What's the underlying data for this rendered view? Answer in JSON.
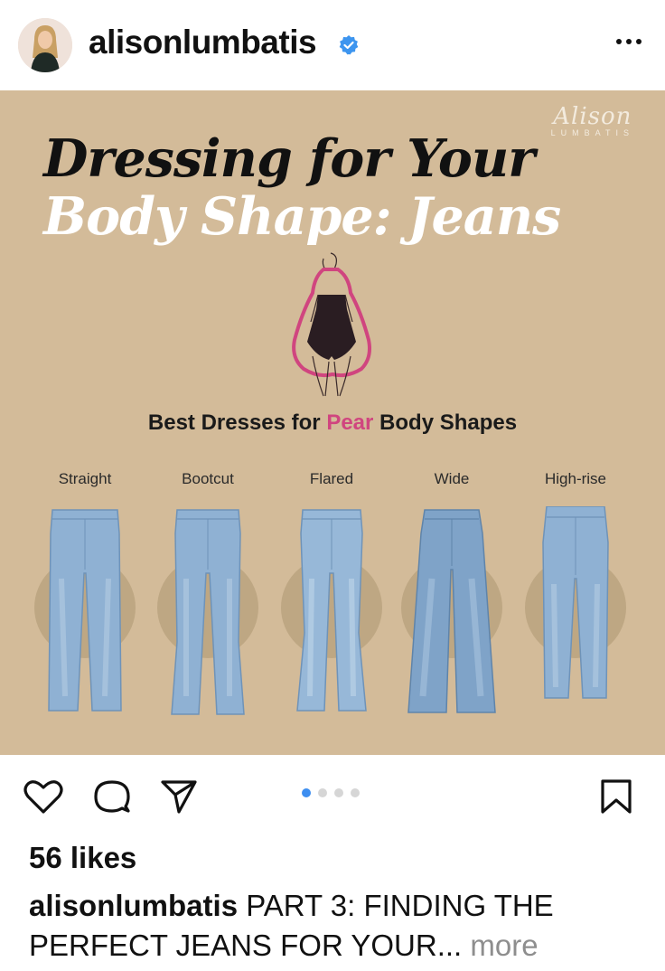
{
  "header": {
    "username": "alisonlumbatis",
    "verified_icon": "verified-badge-icon",
    "menu_icon": "more-options-icon"
  },
  "post": {
    "watermark_script": "Alison",
    "watermark_caps": "LUMBATIS",
    "title_line1": "Dressing for Your",
    "title_line2": "Body Shape: Jeans",
    "subtitle_prefix": "Best Dresses for ",
    "subtitle_accent": "Pear",
    "subtitle_suffix": " Body Shapes",
    "jeans": [
      {
        "label": "Straight",
        "style": "straight"
      },
      {
        "label": "Bootcut",
        "style": "bootcut"
      },
      {
        "label": "Flared",
        "style": "flared"
      },
      {
        "label": "Wide",
        "style": "wide"
      },
      {
        "label": "High-rise",
        "style": "highrise"
      }
    ],
    "colors": {
      "background": "#d3bb99",
      "accent_pink": "#d0457f",
      "denim": "#8fb1d3"
    }
  },
  "actions": {
    "like_icon": "heart-icon",
    "comment_icon": "comment-icon",
    "share_icon": "send-icon",
    "save_icon": "bookmark-icon",
    "carousel_total": 4,
    "carousel_active": 1
  },
  "likes_text": "56 likes",
  "caption": {
    "user": "alisonlumbatis",
    "text": " PART 3: FINDING THE PERFECT JEANS FOR YOUR...",
    "more": " more"
  }
}
